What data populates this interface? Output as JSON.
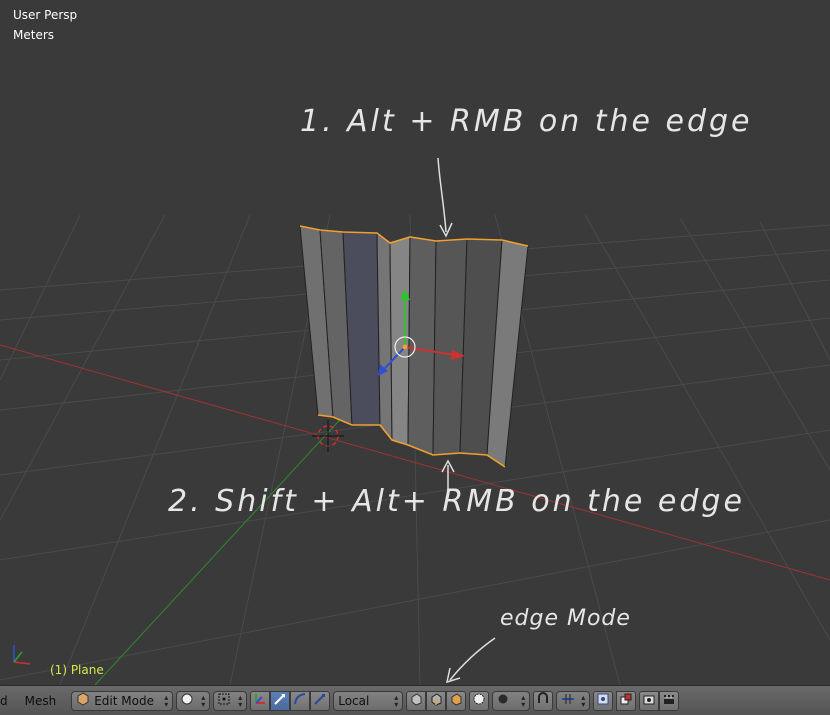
{
  "viewport": {
    "view_name": "User Persp",
    "units": "Meters",
    "object_label": "(1) Plane",
    "annotations": {
      "step1": "1. Alt + RMB on the edge",
      "step2": "2. Shift + Alt+ RMB on the edge",
      "edge_mode": "edge Mode"
    }
  },
  "header": {
    "cut_text": "d",
    "mesh_menu": "Mesh",
    "mode": "Edit Mode",
    "orientation": "Local"
  },
  "colors": {
    "grid_bg": "#3a3a3a",
    "x_axis": "#c03030",
    "y_axis": "#2f8f2f",
    "selected_edge": "#f0a030",
    "active_button": "#5477b0"
  },
  "icons": [
    "mode-icon",
    "shading-solid-icon",
    "pivot-icon",
    "manipulator-icon",
    "translate-icon",
    "rotate-icon",
    "scale-icon",
    "vertex-select-icon",
    "edge-select-icon",
    "face-select-icon",
    "occlude-icon",
    "proportional-icon",
    "snap-icon",
    "snap-element-icon",
    "snap-target-icon",
    "copy-icon",
    "paste-icon",
    "render-icon",
    "render-anim-icon"
  ]
}
